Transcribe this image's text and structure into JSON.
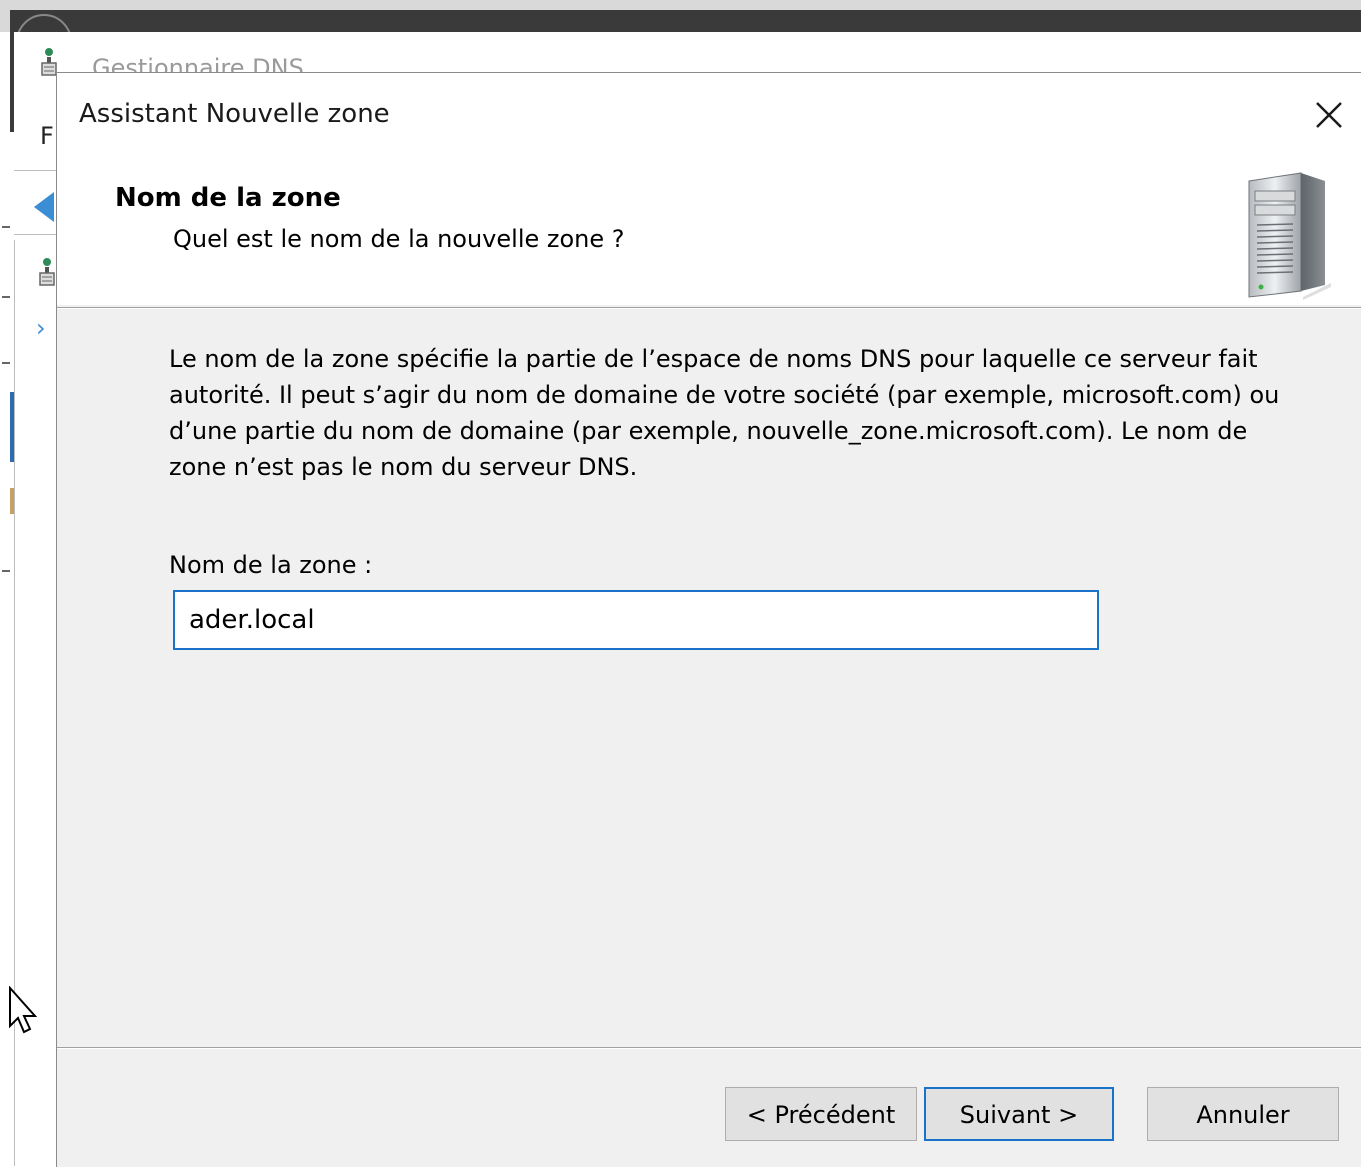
{
  "background_window": {
    "title": "Gestionnaire DNS",
    "menu_letter": "F"
  },
  "dialog": {
    "title": "Assistant Nouvelle zone",
    "header": {
      "title": "Nom de la zone",
      "subtitle": "Quel est le nom de la nouvelle zone ?"
    },
    "description": "Le nom de la zone spécifie la partie de l’espace de noms DNS pour laquelle ce serveur fait autorité. Il peut s’agir du nom de domaine de votre société (par exemple, microsoft.com) ou d’une partie du nom de domaine (par exemple, nouvelle_zone.microsoft.com). Le nom de zone n’est pas le nom du serveur DNS.",
    "zone_field": {
      "label": "Nom de la zone :",
      "value": "ader.local"
    },
    "buttons": {
      "back": "< Précédent",
      "next": "Suivant >",
      "cancel": "Annuler"
    }
  },
  "icons": [
    "dns-server-icon",
    "back-arrow-icon",
    "chevron-right-icon",
    "close-icon",
    "server-icon",
    "mouse-cursor-icon"
  ],
  "colors": {
    "accent": "#1a73c8",
    "dialog_background": "#f0f0f0",
    "header_background": "#ffffff"
  }
}
